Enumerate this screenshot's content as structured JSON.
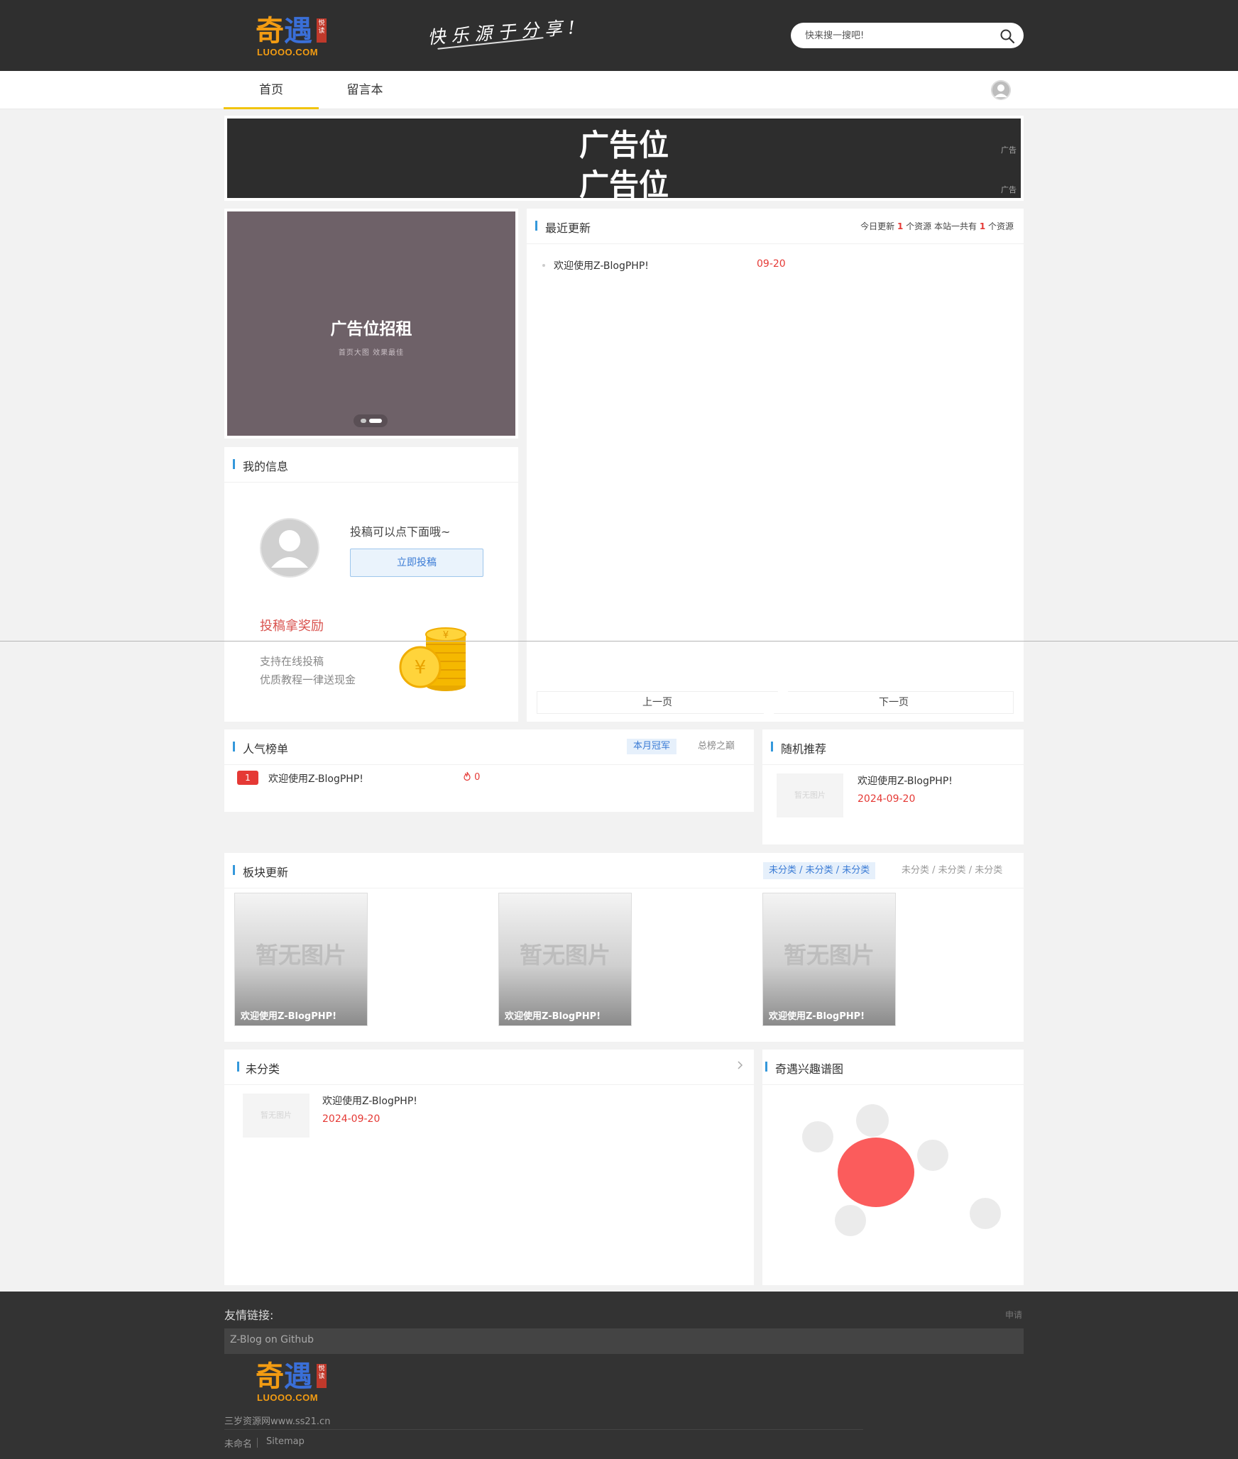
{
  "header": {
    "logo": {
      "glyphs": "奇遇",
      "seal": "悦读",
      "sub": "LUOOO.COM"
    },
    "slogan": "快乐源于分享!",
    "search": {
      "placeholder": "快来搜一搜吧!",
      "value": "",
      "icon": "search-icon"
    }
  },
  "nav": {
    "items": [
      {
        "label": "首页",
        "active": true
      },
      {
        "label": "留言本",
        "active": false
      }
    ],
    "avatar_icon": "user-avatar-icon"
  },
  "top_ad": {
    "line1": "广告位",
    "line2": "广告位",
    "tag": "广告"
  },
  "slider_ad": {
    "title": "广告位招租",
    "subtitle": "首页大图 效果最佳",
    "active_dot": 1,
    "dots": 2
  },
  "my_info": {
    "title": "我的信息",
    "hint": "投稿可以点下面哦~",
    "submit_button": "立即投稿",
    "reward_title": "投稿拿奖励",
    "reward_line1": "支持在线投稿",
    "reward_line2": "优质教程一律送现金",
    "icons": [
      "default-avatar-icon",
      "gold-coins-icon"
    ]
  },
  "recent": {
    "title": "最近更新",
    "stats": {
      "prefix": "今日更新 ",
      "today": "1",
      "middle": " 个资源 本站一共有 ",
      "total": "1",
      "suffix": " 个资源"
    },
    "items": [
      {
        "title": "欢迎使用Z-BlogPHP!",
        "date": "09-20"
      }
    ],
    "prev": "上一页",
    "next": "下一页"
  },
  "popular": {
    "title": "人气榜单",
    "tabs": [
      "本月冠军",
      "总榜之巅"
    ],
    "active_tab": 0,
    "items": [
      {
        "rank": "1",
        "title": "欢迎使用Z-BlogPHP!",
        "views": "0"
      }
    ],
    "hot_icon": "flame-icon"
  },
  "random": {
    "title": "随机推荐",
    "items": [
      {
        "image": "暂无图片",
        "title": "欢迎使用Z-BlogPHP!",
        "date": "2024-09-20"
      }
    ]
  },
  "blocks": {
    "title": "板块更新",
    "tabs": [
      "未分类 / 未分类 / 未分类",
      "未分类 / 未分类 / 未分类"
    ],
    "active_tab": 0,
    "items": [
      {
        "placeholder": "暂无图片",
        "title": "欢迎使用Z-BlogPHP!"
      },
      {
        "placeholder": "暂无图片",
        "title": "欢迎使用Z-BlogPHP!"
      },
      {
        "placeholder": "暂无图片",
        "title": "欢迎使用Z-BlogPHP!"
      }
    ]
  },
  "uncat": {
    "title": "未分类",
    "more_icon": "chevron-right-icon",
    "items": [
      {
        "image": "暂无图片",
        "title": "欢迎使用Z-BlogPHP!",
        "date": "2024-09-20"
      }
    ]
  },
  "interest": {
    "title": "奇遇兴趣谱图",
    "bubble_color_main": "#fb5c5c",
    "bubble_color": "#ebebeb"
  },
  "footer": {
    "links_title": "友情链接:",
    "apply": "申请",
    "links": [
      "Z-Blog on Github"
    ],
    "site": "三岁资源网www.ss21.cn",
    "bottom_links": [
      "未命名",
      "Sitemap"
    ]
  },
  "colors": {
    "header_bg": "#2f2f2f",
    "accent_red": "#e53935",
    "accent_blue": "#3498db",
    "nav_active": "#f1c40f"
  }
}
